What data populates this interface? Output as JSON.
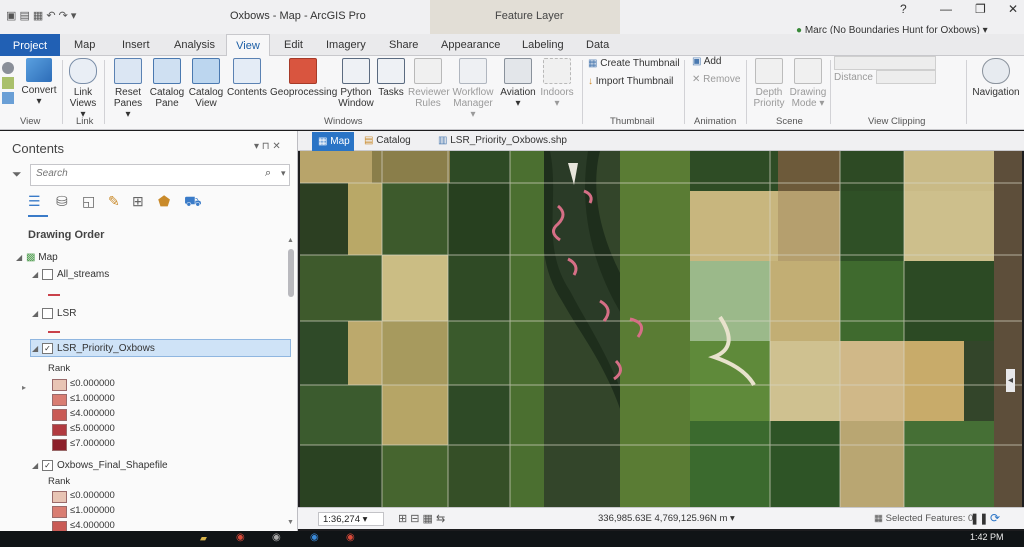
{
  "app": {
    "title": "Oxbows - Map - ArcGIS Pro",
    "context_tab": "Feature Layer",
    "user": "Marc (No Boundaries Hunt for Oxbows)",
    "help": "?"
  },
  "tabs": [
    "Project",
    "Map",
    "Insert",
    "Analysis",
    "View",
    "Edit",
    "Imagery",
    "Share",
    "Appearance",
    "Labeling",
    "Data"
  ],
  "ribbon": {
    "view_group": {
      "label": "View",
      "convert": "Convert"
    },
    "link_group": {
      "label": "Link",
      "link_views_1": "Link",
      "link_views_2": "Views ▾"
    },
    "windows_group": {
      "label": "Windows",
      "items": [
        {
          "l1": "Reset",
          "l2": "Panes ▾"
        },
        {
          "l1": "Catalog",
          "l2": "Pane"
        },
        {
          "l1": "Catalog",
          "l2": "View"
        },
        {
          "l1": "Contents",
          "l2": ""
        },
        {
          "l1": "Geoprocessing",
          "l2": ""
        },
        {
          "l1": "Python",
          "l2": "Window"
        },
        {
          "l1": "Tasks",
          "l2": ""
        },
        {
          "l1": "Reviewer",
          "l2": "Rules"
        },
        {
          "l1": "Workflow",
          "l2": "Manager ▾"
        },
        {
          "l1": "Aviation",
          "l2": "▾"
        },
        {
          "l1": "Indoors",
          "l2": "▾"
        }
      ]
    },
    "thumbnail_group": {
      "label": "Thumbnail",
      "create": "Create Thumbnail",
      "import": "Import Thumbnail"
    },
    "animation_group": {
      "label": "Animation",
      "add": "Add",
      "remove": "Remove"
    },
    "scene_group": {
      "label": "Scene",
      "depth_1": "Depth",
      "depth_2": "Priority",
      "drawing_1": "Drawing",
      "drawing_2": "Mode ▾"
    },
    "clipping_group": {
      "label": "View Clipping",
      "distance": "Distance"
    },
    "navigation": "Navigation"
  },
  "contents": {
    "title": "Contents",
    "search_placeholder": "Search",
    "drawing_order": "Drawing Order",
    "layers": {
      "map": "Map",
      "all_streams": "All_streams",
      "lsr": "LSR",
      "lsr_priority": "LSR_Priority_Oxbows",
      "rank_label": "Rank",
      "lsr_priority_legend": [
        "≤0.000000",
        "≤1.000000",
        "≤4.000000",
        "≤5.000000",
        "≤7.000000"
      ],
      "oxbows_final": "Oxbows_Final_Shapefile",
      "oxbows_legend": [
        "≤0.000000",
        "≤1.000000",
        "≤4.000000"
      ]
    }
  },
  "legend_colors": [
    "#e8c4b4",
    "#d97d72",
    "#c95a55",
    "#b13a3f",
    "#8c1f2a"
  ],
  "map_tabs": {
    "map": "Map",
    "catalog": "Catalog",
    "shapefile": "LSR_Priority_Oxbows.shp"
  },
  "status": {
    "scale": "1:36,274",
    "coords": "336,985.63E 4,769,125.96N m",
    "selected": "Selected Features: 0"
  },
  "taskbar": {
    "time": "1:42 PM"
  }
}
